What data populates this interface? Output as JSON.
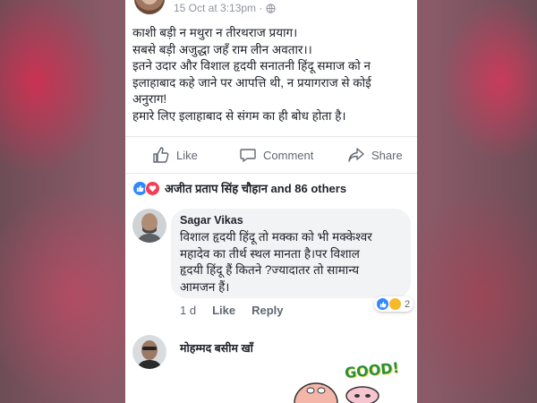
{
  "post": {
    "meta": "15 Oct at 3:13pm · ",
    "icons": [
      "globe-icon"
    ],
    "lines": [
      "काशी बड़ी न मथुरा न तीरथराज प्रयाग।",
      "सबसे बड़ी अजुद्धा जहँ राम लीन अवतार।।",
      "इतने उदार और विशाल हृदयी सनातनी हिंदू समाज को न",
      "इलाहाबाद कहे जाने पर आपत्ति थी, न प्रयागराज से कोई",
      "अनुराग!",
      "हमारे लिए इलाहाबाद से संगम का ही बोध होता है।"
    ]
  },
  "actions": {
    "like": "Like",
    "comment": "Comment",
    "share": "Share"
  },
  "reactions": {
    "summary": "अजीत प्रताप सिंह चौहान and 86 others",
    "icons": [
      "like-reaction-icon",
      "love-reaction-icon"
    ]
  },
  "comments": [
    {
      "name": "Sagar Vikas",
      "text_lines": [
        "विशाल हृदयी हिंदू तो मक्का को भी मक्केश्वर",
        "महादेव का तीर्थ स्थल मानता है।पर विशाल",
        "हृदयी हिंदू हैं कितने ?ज्यादातर तो सामान्य",
        "आमजन हैं।"
      ],
      "time": "1 d",
      "like_label": "Like",
      "reply_label": "Reply",
      "reaction_count": "2"
    },
    {
      "name": "मोहम्मद बसीम खाँ",
      "sticker_text": "GOOD!"
    }
  ],
  "colors": {
    "facebook_blue": "#2d88ff",
    "love_red": "#f33e58",
    "text": "#1d2129",
    "muted": "#606770"
  }
}
